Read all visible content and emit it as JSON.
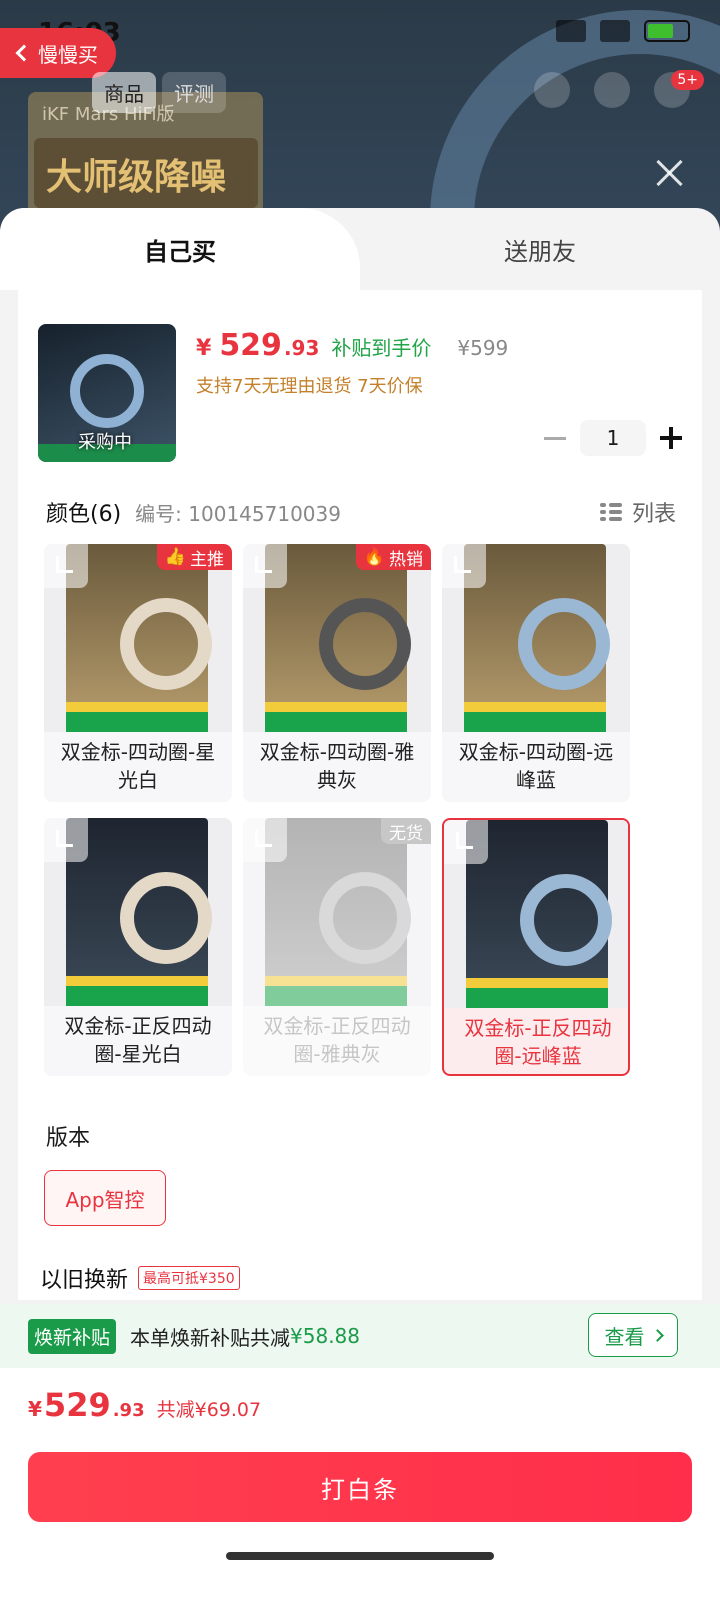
{
  "status_bar": {
    "time": "16:03",
    "battery": "65"
  },
  "background": {
    "card_title": "iKF Mars HiFi版",
    "card_badge": "大师级降噪"
  },
  "nav": {
    "back_label": "慢慢买",
    "tabs": [
      {
        "label": "商品"
      },
      {
        "label": "评测"
      }
    ],
    "message_count": "5+"
  },
  "sheet": {
    "tabs": [
      {
        "label": "自己买"
      },
      {
        "label": "送朋友"
      }
    ]
  },
  "product": {
    "thumb_label": "采购中",
    "price": {
      "currency": "¥",
      "integer": "529",
      "decimal": ".93",
      "note": "补贴到手价",
      "original": "¥599"
    },
    "promise": "支持7天无理由退货  7天价保",
    "quantity": "1"
  },
  "color_section": {
    "title": "颜色(6)",
    "code": "编号: 100145710039",
    "list_label": "列表",
    "options": [
      {
        "label": "双金标-四动圈-星光白",
        "tag": "主推",
        "cup": "#e4d8c6",
        "state": "normal"
      },
      {
        "label": "双金标-四动圈-雅典灰",
        "tag": "热销",
        "cup": "#555555",
        "state": "normal"
      },
      {
        "label": "双金标-四动圈-远峰蓝",
        "tag": "",
        "cup": "#9ab7d4",
        "state": "normal"
      },
      {
        "label": "双金标-正反四动圈-星光白",
        "tag": "",
        "cup": "#e4d8c6",
        "state": "normal"
      },
      {
        "label": "双金标-正反四动圈-雅典灰",
        "tag": "无货",
        "cup": "#bbbbbb",
        "state": "disabled"
      },
      {
        "label": "双金标-正反四动圈-远峰蓝",
        "tag": "",
        "cup": "#9ab7d4",
        "state": "selected"
      }
    ]
  },
  "version_section": {
    "title": "版本",
    "option": "App智控"
  },
  "tradein": {
    "title": "以旧换新",
    "badge": "最高可抵¥350"
  },
  "subsidy": {
    "tag": "焕新补贴",
    "text": "本单焕新补贴共减",
    "amount": "¥58.88",
    "view": "查看"
  },
  "footer": {
    "total": {
      "currency": "¥",
      "integer": "529",
      "decimal": ".93",
      "saved": "共减¥69.07"
    },
    "cta": "打白条"
  },
  "colors": {
    "accent": "#e8343f",
    "green": "#1a9b49"
  }
}
